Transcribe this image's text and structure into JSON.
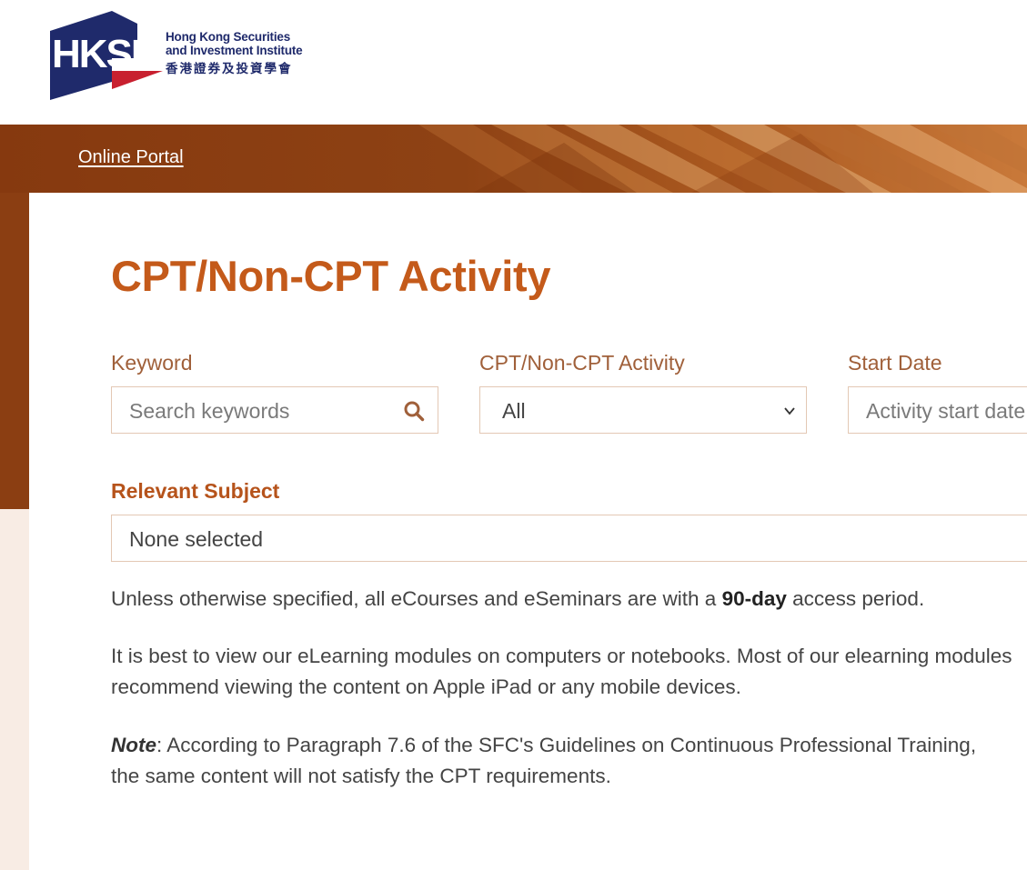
{
  "header": {
    "logo_abbr": "HKSI",
    "logo_name_line1": "Hong Kong Securities",
    "logo_name_line2": "and Investment Institute",
    "logo_name_zh": "香港證券及投資學會"
  },
  "breadcrumb": {
    "link": "Online Portal"
  },
  "page": {
    "title": "CPT/Non-CPT Activity"
  },
  "filters": {
    "keyword": {
      "label": "Keyword",
      "placeholder": "Search keywords"
    },
    "activity": {
      "label": "CPT/Non-CPT Activity",
      "selected": "All"
    },
    "start_date": {
      "label": "Start Date",
      "placeholder": "Activity start date"
    },
    "subject": {
      "label": "Relevant Subject",
      "selected": "None selected"
    }
  },
  "notes": {
    "p1_before": "Unless otherwise specified, all eCourses and eSeminars are with a ",
    "p1_bold": "90-day",
    "p1_after": " access period.",
    "p2_line1": "It is best to view our eLearning modules on computers or notebooks. Most of our elearning modules",
    "p2_line2": "recommend viewing the content on Apple iPad or any mobile devices.",
    "p3_note": "Note",
    "p3_line1": ": According to Paragraph 7.6 of the SFC's Guidelines on Continuous Professional Training,",
    "p3_line2": "the same content will not satisfy the CPT requirements."
  },
  "colors": {
    "brand_navy": "#1f2a6b",
    "brand_red": "#c8202f",
    "accent_orange": "#c45a1a",
    "banner_brown": "#8b3e12"
  }
}
